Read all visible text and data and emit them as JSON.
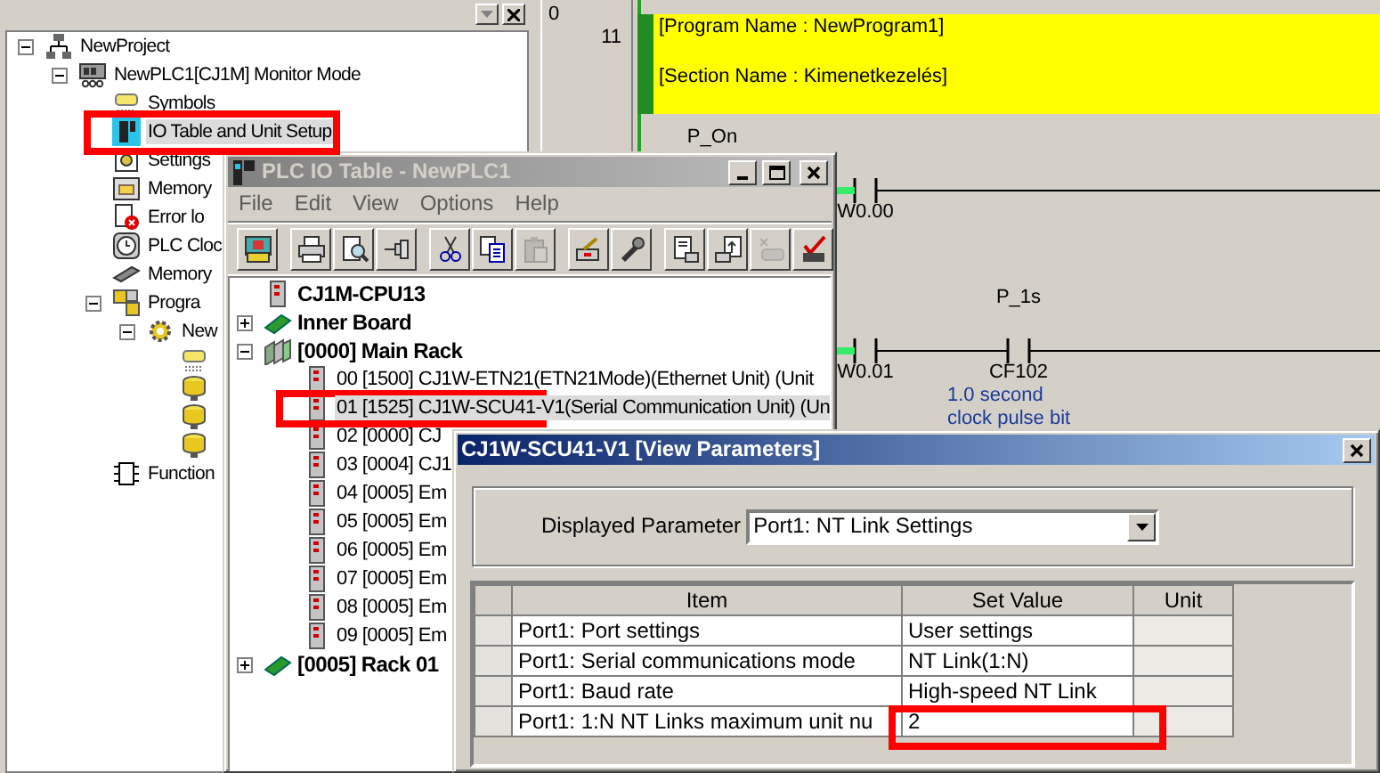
{
  "project_tree": {
    "nodes": [
      {
        "label": "NewProject",
        "kind": "project",
        "expanded": true,
        "selected": false,
        "highlighted": false,
        "children": [
          {
            "label": "NewPLC1[CJ1M] Monitor Mode",
            "kind": "plc",
            "expanded": true,
            "selected": false,
            "highlighted": false,
            "children": [
              {
                "label": "Symbols",
                "kind": "symbols",
                "selected": false,
                "highlighted": false
              },
              {
                "label": "IO Table and Unit Setup",
                "kind": "iotable",
                "selected": true,
                "highlighted": true
              },
              {
                "label": "Settings",
                "kind": "settings",
                "selected": false,
                "highlighted": false
              },
              {
                "label": "Memory",
                "kind": "memory",
                "selected": false,
                "highlighted": false
              },
              {
                "label": "Error lo",
                "kind": "errorlog",
                "selected": false,
                "highlighted": false
              },
              {
                "label": "PLC Cloc",
                "kind": "clock",
                "selected": false,
                "highlighted": false
              },
              {
                "label": "Memory",
                "kind": "memcard",
                "selected": false,
                "highlighted": false
              },
              {
                "label": "Progra",
                "kind": "programs",
                "expanded": true,
                "selected": false,
                "highlighted": false,
                "children": [
                  {
                    "label": "New",
                    "kind": "program",
                    "expanded": true,
                    "selected": false,
                    "highlighted": false,
                    "children": [
                      {
                        "kind": "tag",
                        "selected": false,
                        "highlighted": false
                      },
                      {
                        "kind": "section",
                        "selected": false,
                        "highlighted": false
                      },
                      {
                        "kind": "section",
                        "selected": false,
                        "highlighted": false
                      },
                      {
                        "kind": "section",
                        "selected": false,
                        "highlighted": false
                      }
                    ]
                  }
                ]
              },
              {
                "label": "Function",
                "kind": "func",
                "selected": false,
                "highlighted": false
              }
            ]
          }
        ]
      }
    ]
  },
  "ladder": {
    "rung_number": "0",
    "step": "11",
    "comment_lines": [
      "[Program Name : NewProgram1]",
      "[Section Name : Kimenetkezelés]"
    ],
    "rungs": [
      {
        "cells": [
          {
            "kind": "label",
            "symbol": "P_On"
          },
          {
            "kind": "contact",
            "address": "W0.00",
            "energized": true
          }
        ]
      },
      {
        "cells": [
          {
            "kind": "empty"
          },
          {
            "kind": "contact",
            "address": "W0.01",
            "energized": true
          },
          {
            "kind": "contact",
            "symbol": "P_1s",
            "address": "CF102",
            "energized": false,
            "comment": [
              "1.0 second",
              "clock pulse bit"
            ]
          }
        ]
      }
    ]
  },
  "io_window": {
    "title": "PLC IO Table - NewPLC1",
    "active": false,
    "menu": [
      "File",
      "Edit",
      "View",
      "Options",
      "Help"
    ],
    "toolbar": [
      [
        {
          "kind": "cps",
          "disabled": false
        }
      ],
      [
        {
          "kind": "print",
          "disabled": false
        },
        {
          "kind": "preview",
          "disabled": false
        },
        {
          "kind": "pin",
          "disabled": false
        }
      ],
      [
        {
          "kind": "cut",
          "disabled": false
        },
        {
          "kind": "copy",
          "disabled": false
        },
        {
          "kind": "paste",
          "disabled": true
        }
      ],
      [
        {
          "kind": "transfer",
          "disabled": false
        },
        {
          "kind": "wrench",
          "disabled": false
        }
      ],
      [
        {
          "kind": "read",
          "disabled": false
        },
        {
          "kind": "write",
          "disabled": false
        },
        {
          "kind": "unit",
          "disabled": true
        },
        {
          "kind": "check",
          "disabled": false
        }
      ]
    ],
    "tree": [
      {
        "label": "CJ1M-CPU13",
        "kind": "cpu",
        "selected": false,
        "highlighted": false
      },
      {
        "label": "Inner Board",
        "kind": "board",
        "expanded": false,
        "selected": false,
        "highlighted": false
      },
      {
        "label": "[0000] Main Rack",
        "kind": "rack",
        "expanded": true,
        "selected": false,
        "highlighted": false,
        "children": [
          {
            "label": "00 [1500] CJ1W-ETN21(ETN21Mode)(Ethernet Unit) (Unit",
            "kind": "slot",
            "selected": false,
            "highlighted": false
          },
          {
            "label": "01 [1525] CJ1W-SCU41-V1(Serial Communication Unit) (Un",
            "kind": "slot",
            "selected": true,
            "highlighted": true
          },
          {
            "label": "02 [0000] CJ",
            "kind": "slot",
            "selected": false,
            "highlighted": false
          },
          {
            "label": "03 [0004] CJ1",
            "kind": "slot",
            "selected": false,
            "highlighted": false
          },
          {
            "label": "04 [0005] Em",
            "kind": "slot",
            "selected": false,
            "highlighted": false
          },
          {
            "label": "05 [0005] Em",
            "kind": "slot",
            "selected": false,
            "highlighted": false
          },
          {
            "label": "06 [0005] Em",
            "kind": "slot",
            "selected": false,
            "highlighted": false
          },
          {
            "label": "07 [0005] Em",
            "kind": "slot",
            "selected": false,
            "highlighted": false
          },
          {
            "label": "08 [0005] Em",
            "kind": "slot",
            "selected": false,
            "highlighted": false
          },
          {
            "label": "09 [0005] Em",
            "kind": "slot",
            "selected": false,
            "highlighted": false
          }
        ]
      },
      {
        "label": "[0005] Rack 01",
        "kind": "expansion",
        "expanded": false,
        "selected": false,
        "highlighted": false
      }
    ]
  },
  "dialog": {
    "title": "CJ1W-SCU41-V1 [View Parameters]",
    "active": true,
    "parameter_label": "Displayed Parameter",
    "parameter_value": "Port1: NT Link Settings",
    "columns": [
      "Item",
      "Set Value",
      "Unit"
    ],
    "rows": [
      {
        "item": "Port1: Port settings",
        "value": "User settings",
        "highlighted": false
      },
      {
        "item": "Port1: Serial communications mode",
        "value": "NT Link(1:N)",
        "highlighted": false
      },
      {
        "item": "Port1: Baud rate",
        "value": "High-speed NT Link",
        "highlighted": false
      },
      {
        "item": "Port1: 1:N NT Links maximum unit nu",
        "value": "2",
        "highlighted": true
      }
    ]
  }
}
